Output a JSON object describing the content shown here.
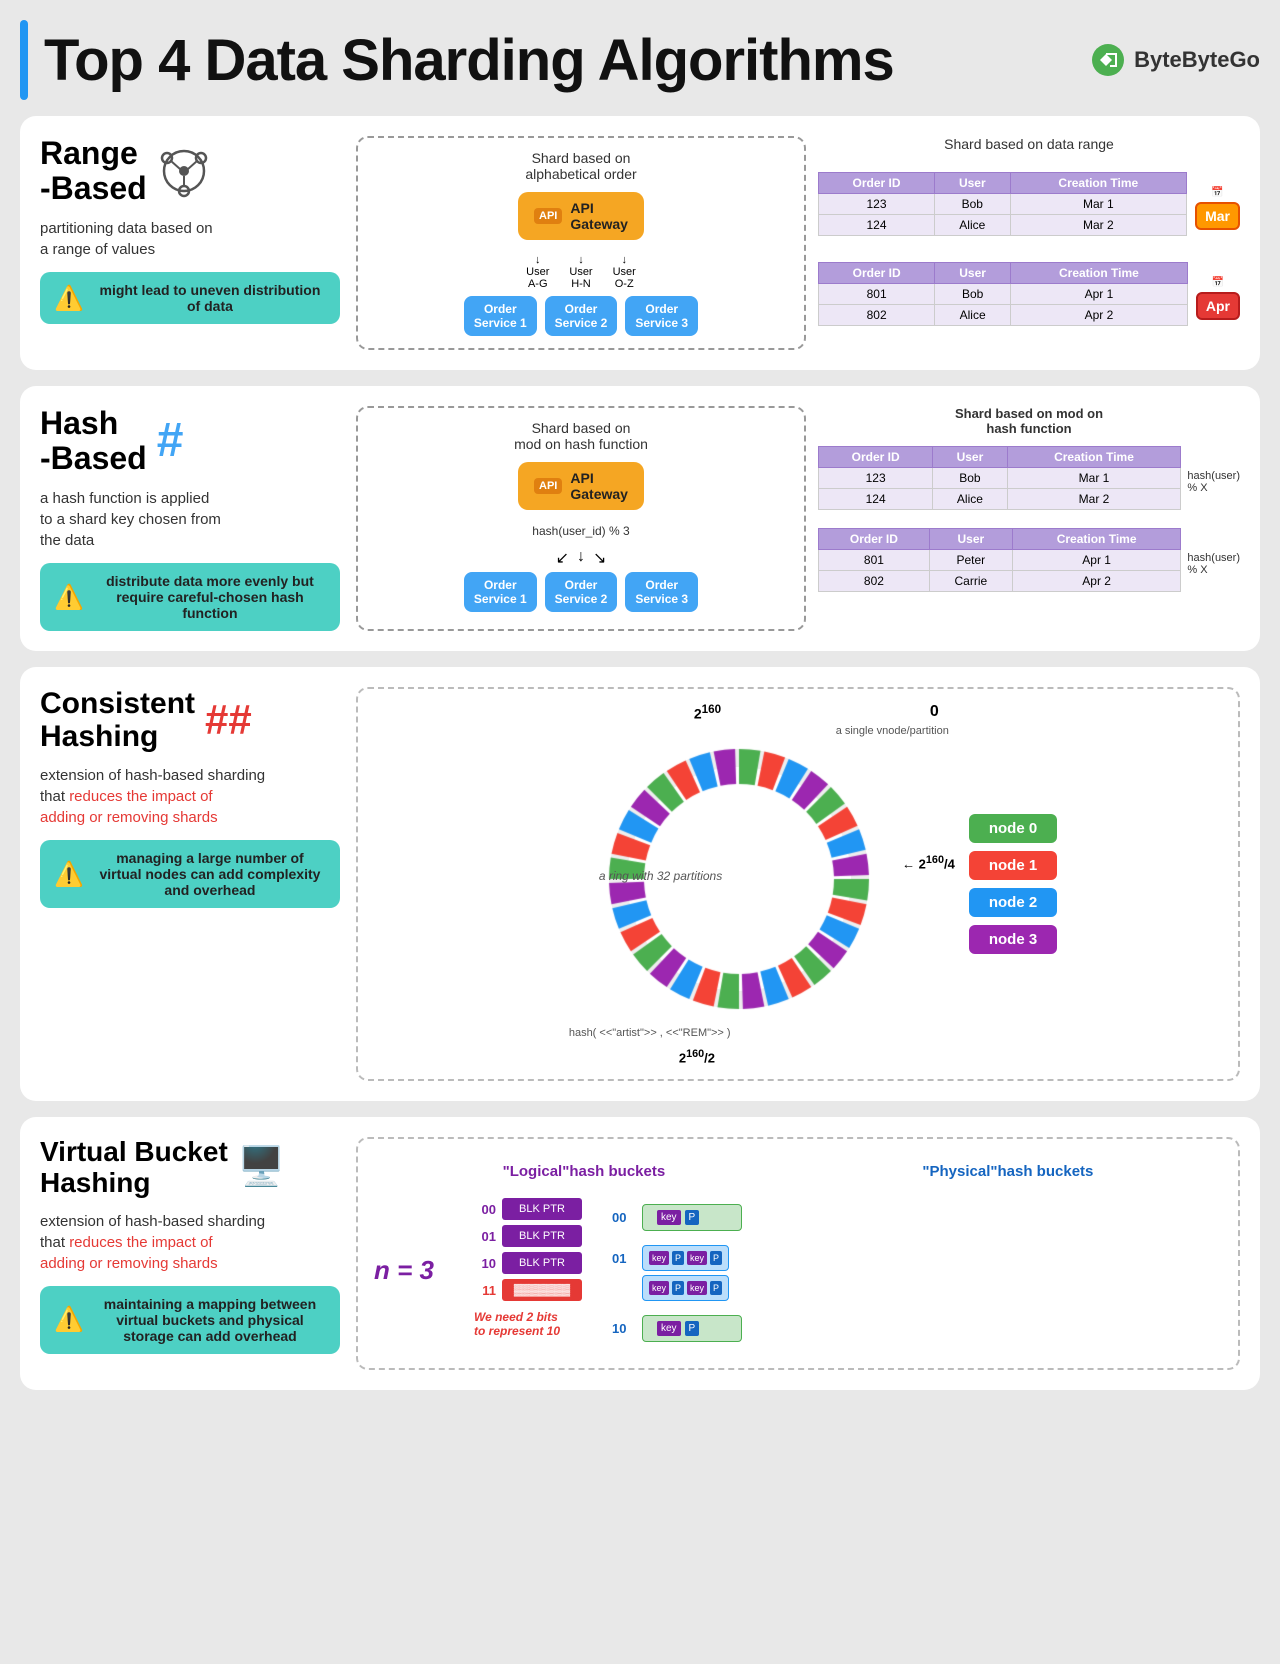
{
  "page": {
    "title": "Top 4 Data Sharding Algorithms",
    "brand": "ByteByteGo"
  },
  "range_based": {
    "title": "Range\n-Based",
    "desc": "partitioning data based on\na range of values",
    "warning": "might lead to uneven\ndistribution of data",
    "diagram_title": "Shard based on\nalphabetical order",
    "api_label": "API\nGateway",
    "user_labels": [
      "User\nA-G",
      "User\nH-N",
      "User\nO-Z"
    ],
    "services": [
      "Order\nService 1",
      "Order\nService 2",
      "Order\nService 3"
    ],
    "right_title": "Shard based on data range",
    "table1": {
      "headers": [
        "Order ID",
        "User",
        "Creation Time"
      ],
      "rows": [
        [
          "123",
          "Bob",
          "Mar 1"
        ],
        [
          "124",
          "Alice",
          "Mar 2"
        ]
      ]
    },
    "table2": {
      "headers": [
        "Order ID",
        "User",
        "Creation Time"
      ],
      "rows": [
        [
          "801",
          "Bob",
          "Apr 1"
        ],
        [
          "802",
          "Alice",
          "Apr 2"
        ]
      ]
    },
    "badge1": "Mar",
    "badge2": "Apr"
  },
  "hash_based": {
    "title": "Hash\n-Based",
    "desc": "a hash function is applied\nto a shard key chosen from\nthe data",
    "warning": "distribute data more evenly\nbut require careful-chosen\nhash function",
    "diagram_title": "Shard based on\nmod on hash function",
    "api_label": "API\nGateway",
    "hash_label": "hash(user_id) % 3",
    "services": [
      "Order\nService 1",
      "Order\nService 2",
      "Order\nService 3"
    ],
    "right_title": "Shard based on mod on\nhash function",
    "table1": {
      "headers": [
        "Order ID",
        "User",
        "Creation Time"
      ],
      "rows": [
        [
          "123",
          "Bob",
          "Mar 1"
        ],
        [
          "124",
          "Alice",
          "Mar 2"
        ]
      ]
    },
    "table2": {
      "headers": [
        "Order ID",
        "User",
        "Creation Time"
      ],
      "rows": [
        [
          "801",
          "Peter",
          "Apr 1"
        ],
        [
          "802",
          "Carrie",
          "Apr 2"
        ]
      ]
    },
    "hash_label1": "hash(user)\n% X",
    "hash_label2": "hash(user)\n% X"
  },
  "consistent_hashing": {
    "title": "Consistent\nHashing",
    "desc_prefix": "extension of hash-based sharding\nthat ",
    "desc_red": "reduces the impact of\nadding or removing shards",
    "warning": "managing a large number of\nvirtual nodes can add\ncomplexity and overhead",
    "ring_label_top": "2¹⁶⁰",
    "ring_label_zero": "0",
    "ring_label_right": "2¹⁶⁰/4",
    "ring_label_bottom": "2¹⁶⁰/2",
    "ring_caption": "a ring with 32 partitions",
    "vnode_label": "a single vnode/partition",
    "hash_label": "hash( <<\"artist\">> , <<\"REM\">> )",
    "nodes": [
      "node 0",
      "node 1",
      "node 2",
      "node 3"
    ]
  },
  "virtual_bucket": {
    "title": "Virtual Bucket\nHashing",
    "desc_prefix": "extension of hash-based sharding\nthat ",
    "desc_red": "reduces the impact of\nadding or removing shards",
    "warning": "maintaining a mapping between\nvirtual buckets and physical\nstorage can add overhead",
    "n_label": "n = 3",
    "logical_title": "\"Logical\"hash buckets",
    "physical_title": "\"Physical\"hash buckets",
    "logical_buckets": [
      "00",
      "01",
      "10",
      "11"
    ],
    "bucket_content": "BLK PTR",
    "physical_labels": [
      "00",
      "01",
      "10"
    ],
    "we_need_label": "We need 2 bits\nto represent 10"
  }
}
